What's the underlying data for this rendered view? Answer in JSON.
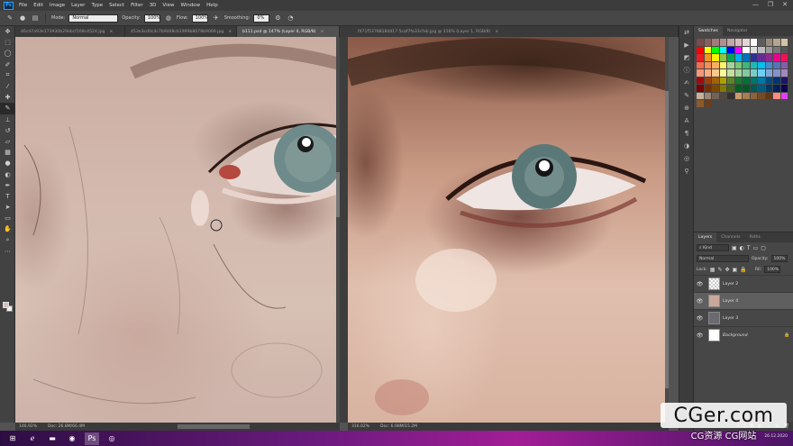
{
  "app": {
    "logo": "Ps"
  },
  "menu": [
    "File",
    "Edit",
    "Image",
    "Layer",
    "Type",
    "Select",
    "Filter",
    "3D",
    "View",
    "Window",
    "Help"
  ],
  "window_controls": [
    "—",
    "❐",
    "✕"
  ],
  "options": {
    "mode_label": "Mode:",
    "mode_value": "Normal",
    "opacity_label": "Opacity:",
    "opacity_value": "100%",
    "flow_label": "Flow:",
    "flow_value": "100%",
    "smoothing_label": "Smoothing:",
    "smoothing_value": "0%"
  },
  "tabs": [
    {
      "label": "46cd7a93e173930b29ebcf108c4524.jpg",
      "active": false
    },
    {
      "label": "453e3cd0c4c7b9d48cb1999b8078b9069.jpg",
      "active": false
    },
    {
      "label": "b111.psd @ 147% (Layer 4, RGB/8)",
      "active": true
    },
    {
      "label": "f471f53788184d17.5caf7fa33cfab.jpg @ 316% (Layer 1, RGB/8)",
      "active": false
    }
  ],
  "status_left": {
    "zoom": "146.92%",
    "doc": "Doc: 26.8M/66.4M"
  },
  "status_right": {
    "zoom": "316.02%",
    "doc": "Doc: 6.08M/15.2M"
  },
  "panels": {
    "top_tabs": [
      "Swatches",
      "Navigator"
    ],
    "layer_tabs": [
      "Layers",
      "Channels",
      "Paths"
    ],
    "kind_label": "Kind",
    "blend": "Normal",
    "opacity_label": "Opacity:",
    "opacity_value": "100%",
    "lock_label": "Lock:",
    "fill_label": "Fill:",
    "fill_value": "100%",
    "layers": [
      {
        "name": "Layer 2",
        "active": false,
        "italic": false,
        "thumb": "checker",
        "locked": false
      },
      {
        "name": "Layer 4",
        "active": true,
        "italic": false,
        "thumb": "#c9a79b",
        "locked": false
      },
      {
        "name": "Layer 3",
        "active": false,
        "italic": false,
        "thumb": "#6a6a70",
        "locked": false
      },
      {
        "name": "Background",
        "active": false,
        "italic": true,
        "thumb": "#ffffff",
        "locked": true
      }
    ]
  },
  "swatch_colors": [
    "#7a4a4a",
    "#8c5f5f",
    "#a47a7a",
    "#b39090",
    "#c4a6a6",
    "#d5bcbc",
    "#e6d3d3",
    "#ffffff",
    "#5d5d5d",
    "#9a8a7a",
    "#b8a48a",
    "#d4c4a4",
    "#ff0000",
    "#ffff00",
    "#00ff00",
    "#00ffff",
    "#0000ff",
    "#ff00ff",
    "#ffffff",
    "#dddddd",
    "#bbbbbb",
    "#999999",
    "#777777",
    "#555555",
    "#ed1c24",
    "#f7941d",
    "#fff200",
    "#8dc63f",
    "#00a651",
    "#00aeef",
    "#0072bc",
    "#2e3192",
    "#662d91",
    "#92278f",
    "#ec008c",
    "#ed145b",
    "#f26c4f",
    "#f68e56",
    "#fbaf5d",
    "#fff568",
    "#a3d39c",
    "#7cc576",
    "#3bb878",
    "#1abbb4",
    "#00bff3",
    "#438ccb",
    "#5674b9",
    "#8560a8",
    "#f7977a",
    "#f9ad81",
    "#fdc68a",
    "#fff79a",
    "#c4df9b",
    "#a3d39c",
    "#82ca9c",
    "#7accc8",
    "#6dcff6",
    "#7ea7d8",
    "#8493ca",
    "#a187be",
    "#9e0b0f",
    "#a0410d",
    "#a36209",
    "#aba000",
    "#598527",
    "#1a7b30",
    "#007236",
    "#00746b",
    "#0076a3",
    "#004b80",
    "#003471",
    "#1b1464",
    "#790000",
    "#7b2e00",
    "#7d4900",
    "#827b00",
    "#406618",
    "#005e20",
    "#005826",
    "#005952",
    "#005b7f",
    "#003663",
    "#002157",
    "#0d004c",
    "#c7b299",
    "#998675",
    "#736357",
    "#534741",
    "#37302d",
    "#c69c6d",
    "#a67c52",
    "#8c6239",
    "#754c24",
    "#603913",
    "#ff8a80",
    "#e040fb",
    "#8b5a2b",
    "#6b3e1e"
  ],
  "taskbar": {
    "clock": "26.12.2020"
  },
  "watermark": {
    "main": "CGer.com",
    "sub": "CG资源 CG网站"
  }
}
